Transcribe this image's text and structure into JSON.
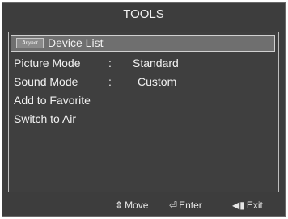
{
  "header": {
    "title": "TOOLS"
  },
  "menu": {
    "selected": {
      "badge": "Anynet",
      "label": "Device List"
    },
    "items": [
      {
        "label": "Picture Mode",
        "sep": ":",
        "value": "Standard"
      },
      {
        "label": "Sound Mode",
        "sep": ":",
        "value": "Custom"
      },
      {
        "label": "Add to Favorite"
      },
      {
        "label": "Switch to Air"
      }
    ]
  },
  "footer": {
    "move": {
      "icon": "⇕",
      "label": "Move"
    },
    "enter": {
      "icon": "⏎",
      "label": "Enter"
    },
    "exit": {
      "icon": "◀▮",
      "label": "Exit"
    }
  }
}
